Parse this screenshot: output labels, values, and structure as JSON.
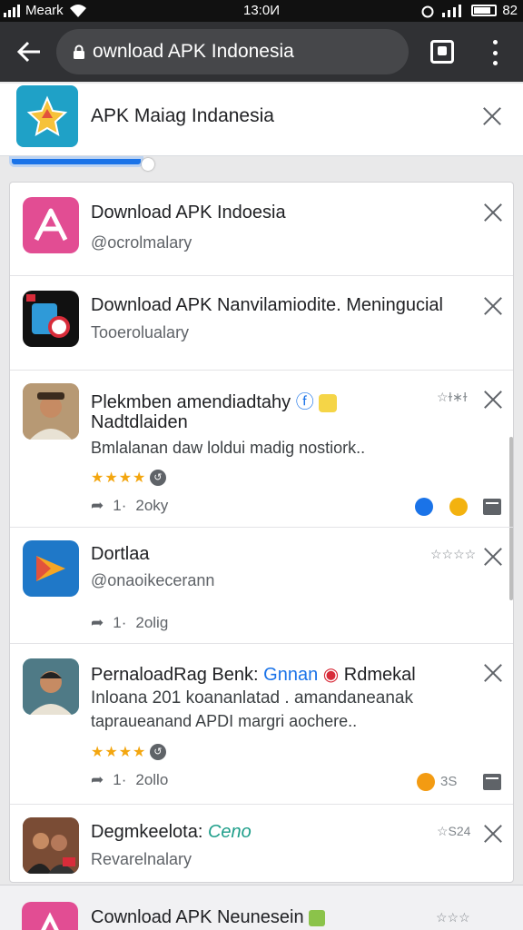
{
  "status_bar": {
    "carrier": "Meark",
    "time": "13:0И",
    "battery": "82"
  },
  "toolbar": {
    "url": "ownload APK Indonesia",
    "icons": [
      "back-arrow-icon",
      "lock-icon",
      "tabs-icon",
      "more-vert-icon"
    ]
  },
  "header": {
    "title": "APK Maiag Indanesia"
  },
  "items": [
    {
      "title": "Download APK Indoesia",
      "subtitle": "@ocrolmalary"
    },
    {
      "title": "Download APK Nanvilamiodite. Meningucial",
      "subtitle": "Tooerolualary"
    },
    {
      "title": "Plekmben amendiadtahy",
      "title_line2": "Nadtdlaiden",
      "desc": "Bmlalanan daw loldui madig nostiork..",
      "rating_small": "☆ɫ∗ɫ",
      "stars": "★★★★",
      "meta_count": "1·",
      "meta_time": "2oky"
    },
    {
      "title": "Dortlaa",
      "subtitle": "@onaoikecerann",
      "rating_small": "☆☆☆☆",
      "meta_count": "1·",
      "meta_time": "2olig"
    },
    {
      "title": "PernaloadRag Benk:",
      "title_tag": "Gnnan",
      "title_tail": "Rdmekal",
      "line2": "Inloana 201 koananlatad . amandaneanak",
      "desc": "tapraueanand APDI margri aochere..",
      "stars": "★★★★",
      "meta_count": "1·",
      "meta_time": "2ollo",
      "action_count": "3S"
    },
    {
      "title": "Degmkeelota:",
      "title_tag": "Ceno",
      "subtitle": "Revarelnalary",
      "rating_small": "☆S24"
    }
  ],
  "bottom_card": {
    "title": "Cownload APK Neunesein",
    "rating_small": "☆☆☆"
  },
  "colors": {
    "toolbar": "#303134",
    "accent_blue": "#1a73e8",
    "star": "#f3a60f"
  }
}
